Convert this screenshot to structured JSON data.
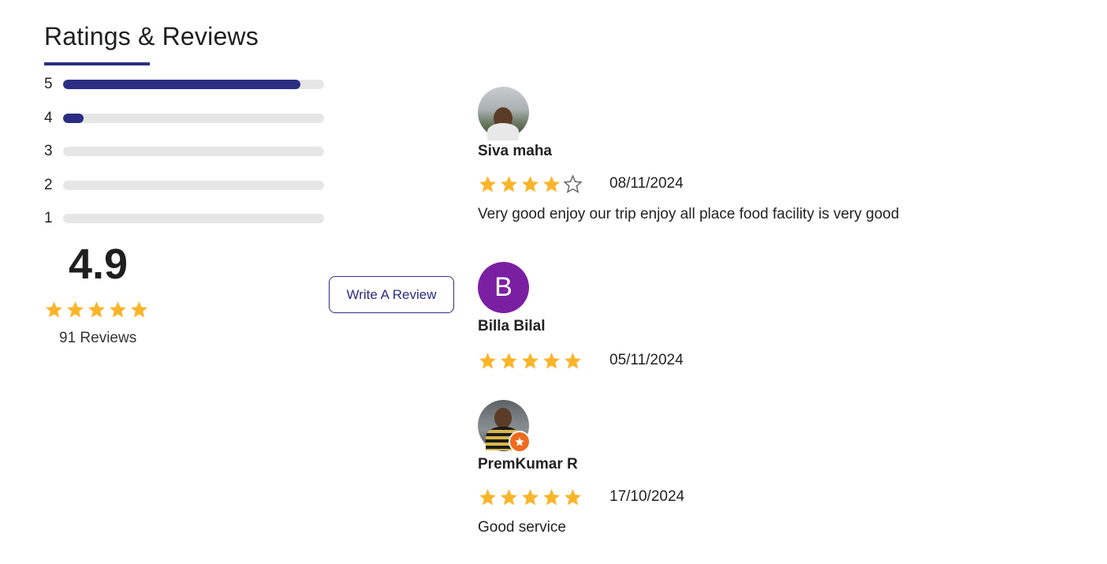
{
  "section": {
    "title": "Ratings & Reviews"
  },
  "distribution": [
    {
      "star": "5",
      "fraction": 0.91
    },
    {
      "star": "4",
      "fraction": 0.08
    },
    {
      "star": "3",
      "fraction": 0
    },
    {
      "star": "2",
      "fraction": 0
    },
    {
      "star": "1",
      "fraction": 0
    }
  ],
  "summary": {
    "average": "4.9",
    "stars_filled": 5,
    "review_count_label": "91 Reviews"
  },
  "write_review_label": "Write A Review",
  "colors": {
    "accent": "#2b2d83",
    "star": "#f9b52a",
    "track": "#e6e6e6",
    "avatar_letter_bg": "#7b1fa2",
    "badge": "#f06a1d"
  },
  "reviews": [
    {
      "name": "Siva maha",
      "avatar": "photo",
      "rating": 4,
      "date": "08/11/2024",
      "text": "Very good enjoy our trip enjoy all place food facility is very good"
    },
    {
      "name": "Billa Bilal",
      "avatar_letter": "B",
      "rating": 5,
      "date": "05/11/2024",
      "text": ""
    },
    {
      "name": "PremKumar R",
      "avatar": "photo-with-badge",
      "rating": 5,
      "date": "17/10/2024",
      "text": "Good service"
    }
  ]
}
